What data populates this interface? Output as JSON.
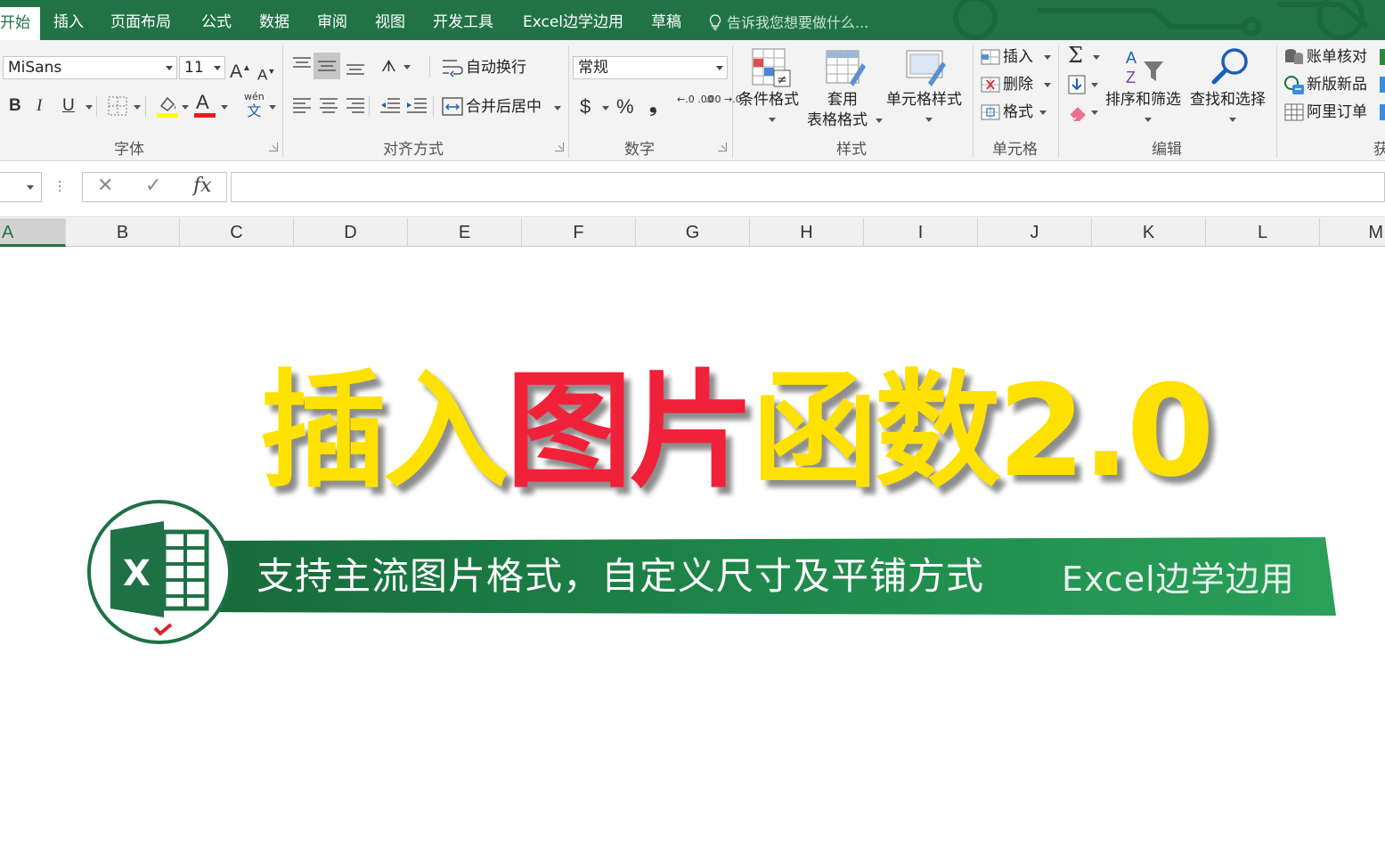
{
  "tabs": {
    "items": [
      "开始",
      "插入",
      "页面布局",
      "公式",
      "数据",
      "审阅",
      "视图",
      "开发工具",
      "Excel边学边用",
      "草稿"
    ],
    "active_index": 0,
    "tell_me": "告诉我您想要做什么..."
  },
  "font_group": {
    "font_name": "MiSans",
    "font_size": "11",
    "grow": "A",
    "shrink": "A",
    "bold": "B",
    "italic": "I",
    "underline": "U",
    "phonetic_top": "wén",
    "phonetic_bottom": "文",
    "label": "字体"
  },
  "alignment_group": {
    "wrap_text": "自动换行",
    "merge_center": "合并后居中",
    "label": "对齐方式"
  },
  "number_group": {
    "format": "常规",
    "currency": "$",
    "percent": "%",
    "comma": "❟",
    "inc_decimal": "←.0 .00",
    "dec_decimal": ".00 →.0",
    "label": "数字"
  },
  "styles_group": {
    "conditional": "条件格式",
    "table_line1": "套用",
    "table_line2": "表格格式",
    "cell_styles": "单元格样式",
    "label": "样式"
  },
  "cells_group": {
    "insert": "插入",
    "delete": "删除",
    "format": "格式",
    "label": "单元格"
  },
  "editing_group": {
    "sort_filter": "排序和筛选",
    "find_select": "查找和选择",
    "sigma": "Σ",
    "label": "编辑"
  },
  "addin_group": {
    "items": [
      "账单核对",
      "新版新品",
      "阿里订单"
    ],
    "label_partial": "获"
  },
  "formula_bar": {
    "cancel": "✕",
    "enter": "✓",
    "fx": "fx",
    "value": ""
  },
  "columns": [
    "A",
    "B",
    "C",
    "D",
    "E",
    "F",
    "G",
    "H",
    "I",
    "J",
    "K",
    "L",
    "M"
  ],
  "banner": {
    "title_part1": "插入",
    "title_part2": "图片",
    "title_part3": "函数2.0",
    "subtitle": "支持主流图片格式，自定义尺寸及平铺方式",
    "brand": "Excel边学边用",
    "logo_letter": "X"
  },
  "colors": {
    "excel_green": "#217346",
    "title_yellow": "#ffe100",
    "title_red": "#f2213a",
    "band_green": "#1e8a4c"
  }
}
